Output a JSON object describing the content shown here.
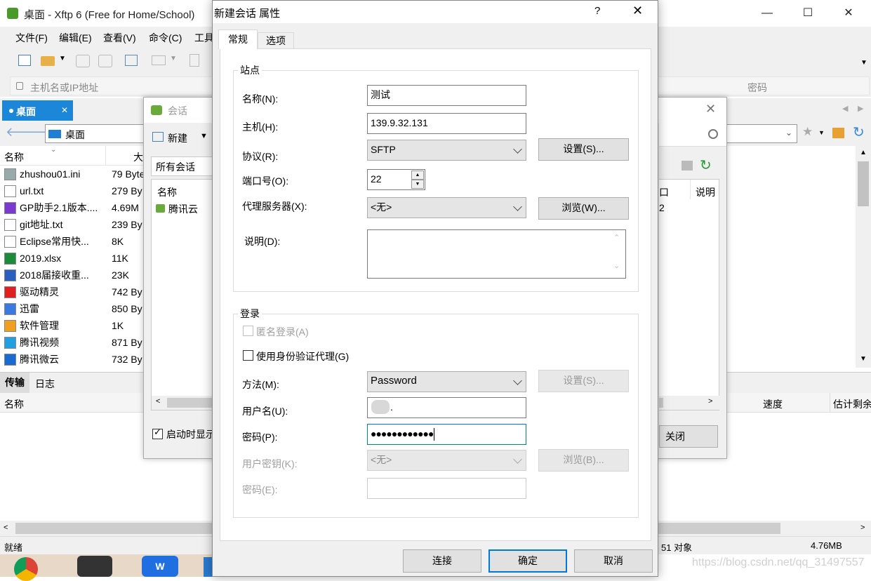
{
  "xftp": {
    "title": "桌面 - Xftp 6 (Free for Home/School)",
    "menu": [
      "文件(F)",
      "编辑(E)",
      "查看(V)",
      "命令(C)",
      "工具"
    ],
    "host_placeholder": "主机名或IP地址",
    "password_label": "密码",
    "local_tab": "桌面",
    "path": "桌面",
    "col_name": "名称",
    "col_size": "大",
    "files": [
      {
        "name": "zhushou01.ini",
        "size": "79 Byte",
        "icon": "ini-file-icon"
      },
      {
        "name": "url.txt",
        "size": "279 By",
        "icon": "text-file-icon"
      },
      {
        "name": "GP助手2.1版本....",
        "size": "4.69M",
        "icon": "app-shortcut-icon"
      },
      {
        "name": "git地址.txt",
        "size": "239 By",
        "icon": "text-file-icon"
      },
      {
        "name": "Eclipse常用快...",
        "size": "8K",
        "icon": "text-file-icon"
      },
      {
        "name": "2019.xlsx",
        "size": "11K",
        "icon": "excel-file-icon"
      },
      {
        "name": "2018届接收重...",
        "size": "23K",
        "icon": "word-file-icon"
      },
      {
        "name": "驱动精灵",
        "size": "742 By",
        "icon": "driver-app-icon"
      },
      {
        "name": "迅雷",
        "size": "850 By",
        "icon": "thunder-app-icon"
      },
      {
        "name": "软件管理",
        "size": "1K",
        "icon": "software-manager-icon"
      },
      {
        "name": "腾讯视频",
        "size": "871 By",
        "icon": "tencent-video-icon"
      },
      {
        "name": "腾讯微云",
        "size": "732 By",
        "icon": "weiyun-icon"
      }
    ],
    "log_tabs": [
      "传输",
      "日志"
    ],
    "log_col_name": "名称",
    "log_col_speed": "速度",
    "log_col_remaining": "估计剩余",
    "status_left": "就绪",
    "status_objects": "51 对象",
    "status_size": "4.76MB",
    "right_col_port": "口",
    "right_col_desc": "说明",
    "right_value": "2"
  },
  "session": {
    "title": "会话",
    "new_button": "新建",
    "tree_root": "所有会话",
    "col_name": "名称",
    "item": "腾讯云",
    "startup_checkbox": "启动时显示",
    "close_button": "关闭"
  },
  "props": {
    "title": "新建会话 属性",
    "help": "?",
    "tabs": [
      "常规",
      "选项"
    ],
    "site_group": "站点",
    "name_label": "名称(N):",
    "name_value": "测试",
    "host_label": "主机(H):",
    "host_value": "139.9.32.131",
    "protocol_label": "协议(R):",
    "protocol_value": "SFTP",
    "setup_button": "设置(S)...",
    "port_label": "端口号(O):",
    "port_value": "22",
    "proxy_label": "代理服务器(X):",
    "proxy_value": "<无>",
    "browse_button": "浏览(W)...",
    "desc_label": "说明(D):",
    "login_group": "登录",
    "anonymous_label": "匿名登录(A)",
    "agent_label": "使用身份验证代理(G)",
    "method_label": "方法(M):",
    "method_value": "Password",
    "method_setup_button": "设置(S)...",
    "user_label": "用户名(U):",
    "user_value": ".",
    "pass_label": "密码(P):",
    "pass_value": "●●●●●●●●●●●●",
    "userkey_label": "用户密钥(K):",
    "userkey_value": "<无>",
    "key_browse_button": "浏览(B)...",
    "passphrase_label": "密码(E):",
    "connect_button": "连接",
    "ok_button": "确定",
    "cancel_button": "取消"
  },
  "watermark": "https://blog.csdn.net/qq_31497557",
  "colors": {
    "accent": "#0078d7",
    "tab_active": "#1c86d9"
  }
}
